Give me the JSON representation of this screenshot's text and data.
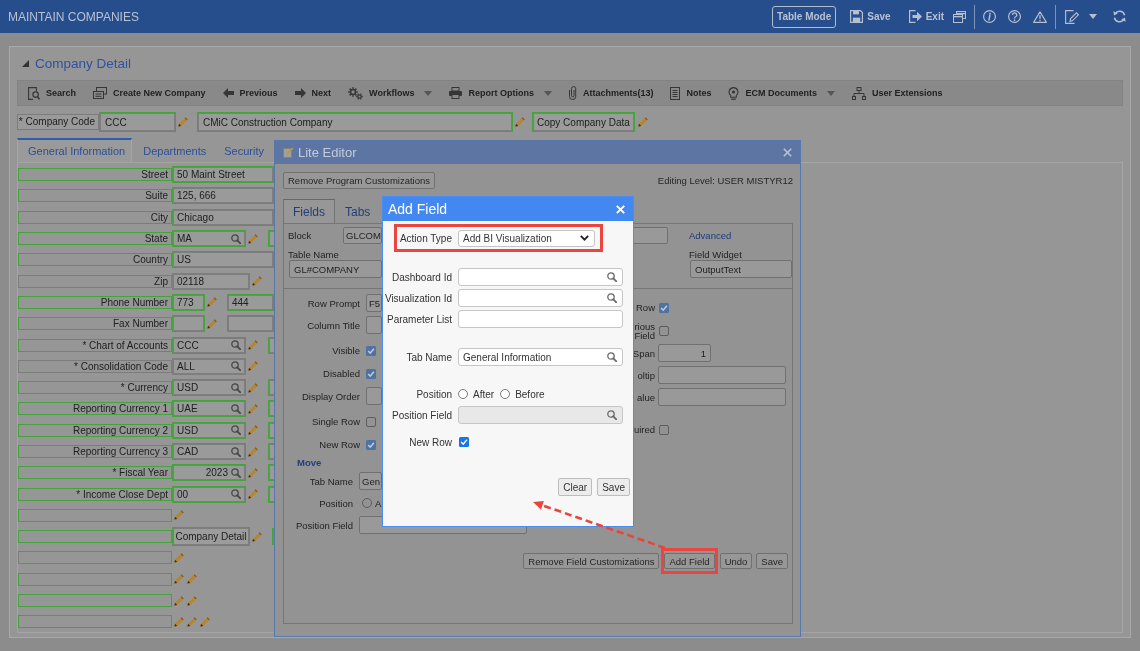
{
  "app_bar": {
    "title": "MAINTAIN COMPANIES",
    "buttons": [
      {
        "label": "Table Mode",
        "framed": true
      },
      {
        "label": "Save",
        "framed": false
      },
      {
        "label": "Exit",
        "framed": false
      }
    ]
  },
  "company_detail": {
    "title": "Company Detail",
    "expanded": true
  },
  "toolbar": [
    {
      "label": "Search",
      "has_menu": false
    },
    {
      "label": "Create New Company",
      "has_menu": false
    },
    {
      "label": "Previous",
      "has_menu": false
    },
    {
      "label": "Next",
      "has_menu": false
    },
    {
      "label": "Workflows",
      "has_menu": true
    },
    {
      "label": "Report Options",
      "has_menu": true
    },
    {
      "label": "Attachments(13)",
      "has_menu": false
    },
    {
      "label": "Notes",
      "has_menu": false
    },
    {
      "label": "ECM Documents",
      "has_menu": true
    },
    {
      "label": "User Extensions",
      "has_menu": false
    }
  ],
  "company_code": {
    "label": "* Company Code",
    "code": "CCC",
    "name": "CMiC Construction Company",
    "copy_button": "Copy Company Data"
  },
  "tabs": [
    {
      "label": "General Information",
      "selected": true
    },
    {
      "label": "Departments",
      "selected": false
    },
    {
      "label": "Security",
      "selected": false
    }
  ],
  "form_rows": [
    {
      "label": "Street",
      "highlighted": true,
      "controls": [
        {
          "kind": "text",
          "value": "50 Maint Street"
        }
      ]
    },
    {
      "label": "Suite",
      "highlighted": true,
      "controls": [
        {
          "kind": "text",
          "value": "125, 666"
        }
      ]
    },
    {
      "label": "City",
      "highlighted": true,
      "controls": [
        {
          "kind": "text",
          "value": "Chicago"
        }
      ]
    },
    {
      "label": "State",
      "highlighted": true,
      "controls": [
        {
          "kind": "lookup",
          "value": "MA"
        },
        {
          "kind": "edit"
        },
        {
          "kind": "part"
        }
      ]
    },
    {
      "label": "Country",
      "highlighted": true,
      "controls": [
        {
          "kind": "text",
          "value": "US"
        }
      ]
    },
    {
      "label": "Zip",
      "highlighted": false,
      "controls": [
        {
          "kind": "code",
          "value": "02118"
        },
        {
          "kind": "edit"
        }
      ]
    },
    {
      "label": "Phone Number",
      "highlighted": true,
      "controls": [
        {
          "kind": "short",
          "value": "773"
        },
        {
          "kind": "edit"
        },
        {
          "kind": "part",
          "value": "444"
        }
      ]
    },
    {
      "label": "Fax Number",
      "highlighted": true,
      "controls": [
        {
          "kind": "short"
        },
        {
          "kind": "edit"
        },
        {
          "kind": "part"
        }
      ]
    },
    {
      "label": "* Chart of Accounts",
      "highlighted": true,
      "controls": [
        {
          "kind": "lookup",
          "value": "CCC"
        },
        {
          "kind": "edit"
        },
        {
          "kind": "part"
        }
      ]
    },
    {
      "label": "* Consolidation Code",
      "highlighted": false,
      "controls": [
        {
          "kind": "lookup",
          "value": "ALL"
        },
        {
          "kind": "edit"
        }
      ]
    },
    {
      "label": "* Currency",
      "highlighted": true,
      "controls": [
        {
          "kind": "lookup",
          "value": "USD"
        },
        {
          "kind": "edit"
        },
        {
          "kind": "part"
        }
      ]
    },
    {
      "label": "Reporting Currency 1",
      "highlighted": true,
      "controls": [
        {
          "kind": "lookup",
          "value": "UAE"
        },
        {
          "kind": "edit"
        },
        {
          "kind": "part"
        }
      ]
    },
    {
      "label": "Reporting Currency 2",
      "highlighted": true,
      "controls": [
        {
          "kind": "lookup",
          "value": "USD"
        },
        {
          "kind": "edit"
        },
        {
          "kind": "part"
        }
      ]
    },
    {
      "label": "Reporting Currency 3",
      "highlighted": true,
      "controls": [
        {
          "kind": "lookup",
          "value": "CAD"
        },
        {
          "kind": "edit"
        },
        {
          "kind": "part"
        }
      ]
    },
    {
      "label": "* Fiscal Year",
      "highlighted": true,
      "controls": [
        {
          "kind": "number_lookup",
          "value": "2023"
        },
        {
          "kind": "edit"
        },
        {
          "kind": "part"
        }
      ]
    },
    {
      "label": "* Income Close Dept",
      "highlighted": true,
      "controls": [
        {
          "kind": "lookup",
          "value": "00"
        },
        {
          "kind": "edit"
        },
        {
          "kind": "part"
        }
      ]
    },
    {
      "highlighted": true,
      "controls": [
        {
          "kind": "edit"
        }
      ]
    },
    {
      "highlighted": true,
      "controls": [
        {
          "kind": "button",
          "value": "Company Detail"
        },
        {
          "kind": "edit"
        },
        {
          "kind": "part"
        }
      ]
    },
    {
      "highlighted": false,
      "controls": [
        {
          "kind": "edit"
        }
      ]
    },
    {
      "highlighted": true,
      "controls": [
        {
          "kind": "edit"
        },
        {
          "kind": "edit"
        }
      ]
    },
    {
      "highlighted": true,
      "controls": [
        {
          "kind": "edit"
        },
        {
          "kind": "edit"
        }
      ]
    },
    {
      "highlighted": true,
      "controls": [
        {
          "kind": "edit"
        },
        {
          "kind": "edit"
        },
        {
          "kind": "edit"
        }
      ]
    }
  ],
  "lite_editor": {
    "title": "Lite Editor",
    "remove_button": "Remove Program Customizations",
    "editing_level": "Editing Level: USER MISTYR12",
    "tabs": [
      {
        "label": "Fields",
        "selected": true
      },
      {
        "label": "Tabs",
        "selected": false
      }
    ],
    "block": {
      "label": "Block",
      "value": "GLCOM"
    },
    "advanced_link": "Advanced",
    "table_name": {
      "label": "Table Name",
      "value": "GL#COMPANY"
    },
    "field_widget": {
      "label": "Field Widget",
      "value": "OutputText"
    },
    "left_rows": [
      {
        "kind": "text",
        "label": "Row Prompt",
        "value": "F5"
      },
      {
        "kind": "text",
        "label": "Column Title"
      },
      {
        "kind": "checkbox",
        "label": "Visible",
        "checked": true
      },
      {
        "kind": "checkbox",
        "label": "Disabled",
        "checked": true
      },
      {
        "kind": "text",
        "label": "Display Order"
      },
      {
        "kind": "checkbox",
        "label": "Single Row",
        "checked": false
      },
      {
        "kind": "checkbox",
        "label": "New Row",
        "checked": true
      }
    ],
    "move": {
      "title": "Move",
      "rows": [
        {
          "kind": "text",
          "label": "Tab Name",
          "value": "Gen"
        },
        {
          "kind": "radio",
          "label": "Position",
          "option": "A",
          "selected": false
        },
        {
          "kind": "wide",
          "label": "Position Field"
        }
      ]
    },
    "right_rows": [
      {
        "kind": "checkbox",
        "label": "Row",
        "checked": true
      },
      {
        "kind": "checkbox",
        "label": "rious Field",
        "checked": false
      },
      {
        "kind": "number",
        "label": "Span",
        "value": "1"
      },
      {
        "kind": "long",
        "label": "oltip"
      },
      {
        "kind": "long",
        "label": "alue"
      },
      {
        "kind": "checkbox",
        "label": "uired",
        "checked": false
      }
    ],
    "buttons": [
      {
        "label": "Remove Field Customizations",
        "highlighted": false
      },
      {
        "label": "Add Field",
        "highlighted": true
      },
      {
        "label": "Undo",
        "highlighted": false
      },
      {
        "label": "Save",
        "highlighted": false
      }
    ]
  },
  "add_field_dialog": {
    "title": "Add Field",
    "action_type": {
      "label": "Action Type",
      "value": "Add BI Visualization",
      "highlighted": true
    },
    "sections": [
      [
        {
          "kind": "lookup",
          "label": "Dashboard Id",
          "disabled": false
        },
        {
          "kind": "lookup",
          "label": "Visualization Id",
          "disabled": false
        },
        {
          "kind": "text",
          "label": "Parameter List",
          "disabled": false
        }
      ],
      [
        {
          "kind": "lookup",
          "label": "Tab Name",
          "value": "General Information",
          "disabled": false
        }
      ],
      [
        {
          "kind": "radio",
          "label": "Position",
          "disabled": false,
          "options": [
            {
              "label": "After",
              "selected": false
            },
            {
              "label": "Before",
              "selected": false
            }
          ]
        },
        {
          "kind": "lookup",
          "label": "Position Field",
          "disabled": true
        },
        {
          "kind": "checkbox",
          "label": "New Row",
          "checked": true,
          "disabled": false
        }
      ]
    ],
    "buttons": [
      {
        "label": "Clear"
      },
      {
        "label": "Save"
      }
    ]
  }
}
